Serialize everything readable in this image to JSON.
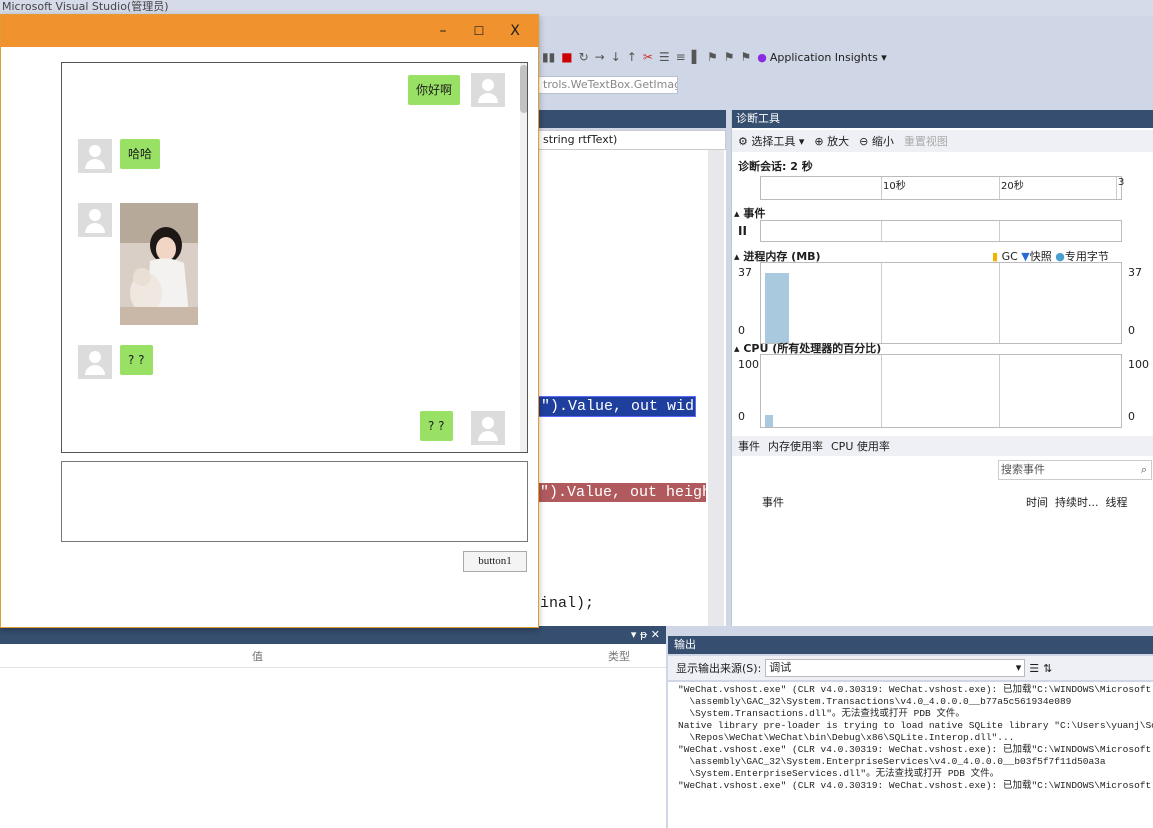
{
  "vs": {
    "title": "Microsoft Visual Studio(管理员)",
    "toolbar_app_insights": "Application Insights ▾",
    "nav_combo": "trols.WeTextBox.GetImage ▾",
    "member_combo": "string rtfText)",
    "code_line1": "\").Value, out width);",
    "code_line2": "\").Value, out height);",
    "code_line3": "inal);"
  },
  "diag": {
    "title": "诊断工具",
    "tool_select": "选择工具 ▾",
    "tool_zoom_in": "放大",
    "tool_zoom_out": "缩小",
    "tool_reset": "重置视图",
    "session": "诊断会话: 2 秒",
    "tick_10": "10秒",
    "tick_20": "20秒",
    "tick_3": "3",
    "sec_events": "▴ 事件",
    "sec_memory": "▴ 进程内存 (MB)",
    "legend_gc": "GC",
    "legend_snapshot": "快照",
    "legend_private": "专用字节",
    "mem_max": "37",
    "mem_min": "0",
    "sec_cpu": "▴ CPU (所有处理器的百分比)",
    "cpu_max": "100",
    "cpu_min": "0",
    "tab_events": "事件",
    "tab_mem": "内存使用率",
    "tab_cpu": "CPU 使用率",
    "search_placeholder": "搜索事件",
    "col_event": "事件",
    "col_time": "时间",
    "col_duration": "持续时...",
    "col_thread": "线程"
  },
  "locals": {
    "col_value": "值",
    "col_type": "类型"
  },
  "output": {
    "title": "输出",
    "source_label": "显示输出来源(S):",
    "source_value": "调试",
    "lines": "\"WeChat.vshost.exe\" (CLR v4.0.30319: WeChat.vshost.exe): 已加载\"C:\\WINDOWS\\Microsoft.Net\n  \\assembly\\GAC_32\\System.Transactions\\v4.0_4.0.0.0__b77a5c561934e089\n  \\System.Transactions.dll\"。无法查找或打开 PDB 文件。\nNative library pre-loader is trying to load native SQLite library \"C:\\Users\\yuanj\\Source\n  \\Repos\\WeChat\\WeChat\\bin\\Debug\\x86\\SQLite.Interop.dll\"...\n\"WeChat.vshost.exe\" (CLR v4.0.30319: WeChat.vshost.exe): 已加载\"C:\\WINDOWS\\Microsoft.Net\n  \\assembly\\GAC_32\\System.EnterpriseServices\\v4.0_4.0.0.0__b03f5f7f11d50a3a\n  \\System.EnterpriseServices.dll\"。无法查找或打开 PDB 文件。\n\"WeChat.vshost.exe\" (CLR v4.0.30319: WeChat.vshost.exe): 已加载\"C:\\WINDOWS\\Microsoft.Net"
  },
  "chat": {
    "minimize": "–",
    "maximize": "☐",
    "close": "X",
    "msg1": "你好啊",
    "msg2": "哈哈",
    "msg3": "? ?",
    "msg4": "? ?",
    "button": "button1"
  },
  "colors": {
    "accent": "#f0922d",
    "bubble": "#98e165",
    "vs_header": "#364e6f"
  }
}
